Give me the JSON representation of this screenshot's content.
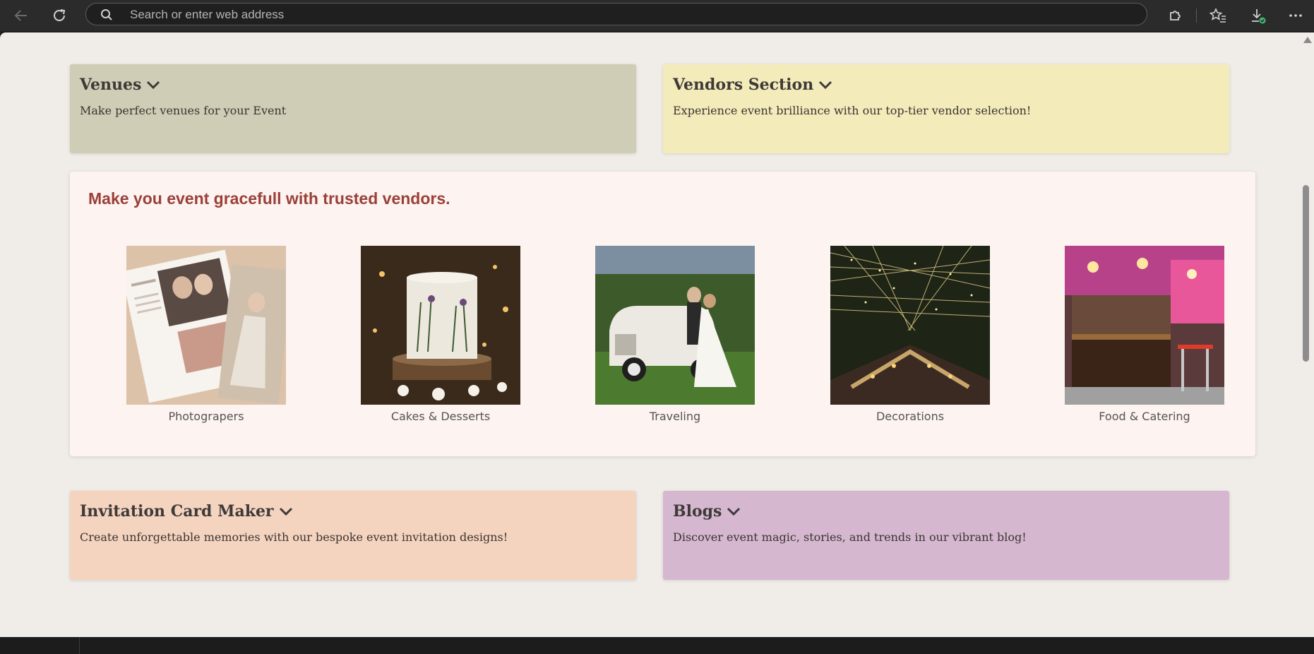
{
  "browser": {
    "address_placeholder": "Search or enter web address"
  },
  "cards": [
    {
      "title": "Venues",
      "description": "Make perfect venues for your Event",
      "bg": "#d0cdb6"
    },
    {
      "title": "Vendors Section",
      "description": "Experience event brilliance with our top-tier vendor selection!",
      "bg": "#f4ebbb"
    },
    {
      "title": "Invitation Card Maker",
      "description": "Create unforgettable memories with our bespoke event invitation designs!",
      "bg": "#f4d3bf"
    },
    {
      "title": "Blogs",
      "description": "Discover event magic, stories, and trends in our vibrant blog!",
      "bg": "#d5b7cf"
    }
  ],
  "vendors": {
    "heading": "Make you event gracefull with trusted vendors.",
    "items": [
      {
        "label": "Photograpers"
      },
      {
        "label": "Cakes & Desserts"
      },
      {
        "label": "Traveling"
      },
      {
        "label": "Decorations"
      },
      {
        "label": "Food & Catering"
      }
    ]
  },
  "colors": {
    "page_bg": "#f0ece8",
    "heading_accent": "#9a4038"
  }
}
